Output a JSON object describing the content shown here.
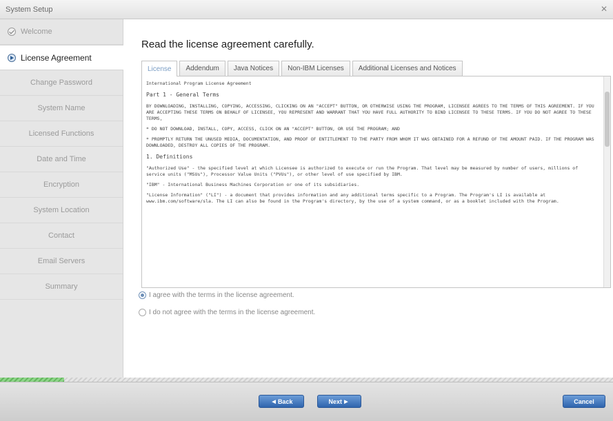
{
  "window": {
    "title": "System Setup",
    "close_icon": "close-icon"
  },
  "sidebar": {
    "items": [
      {
        "label": "Welcome",
        "state": "done",
        "icon": "check-circle-icon"
      },
      {
        "label": "License Agreement",
        "state": "active",
        "icon": "arrow-circle-icon"
      },
      {
        "label": "Change Password",
        "state": "pending"
      },
      {
        "label": "System Name",
        "state": "pending"
      },
      {
        "label": "Licensed Functions",
        "state": "pending"
      },
      {
        "label": "Date and Time",
        "state": "pending"
      },
      {
        "label": "Encryption",
        "state": "pending"
      },
      {
        "label": "System Location",
        "state": "pending"
      },
      {
        "label": "Contact",
        "state": "pending"
      },
      {
        "label": "Email Servers",
        "state": "pending"
      },
      {
        "label": "Summary",
        "state": "pending"
      }
    ]
  },
  "main": {
    "heading": "Read the license agreement carefully.",
    "tabs": [
      {
        "label": "License",
        "active": true
      },
      {
        "label": "Addendum",
        "active": false
      },
      {
        "label": "Java Notices",
        "active": false
      },
      {
        "label": "Non-IBM Licenses",
        "active": false
      },
      {
        "label": "Additional Licenses and Notices",
        "active": false
      }
    ],
    "license": {
      "paragraphs": [
        "International Program License Agreement",
        "Part 1 - General Terms",
        "BY DOWNLOADING, INSTALLING, COPYING, ACCESSING, CLICKING ON AN \"ACCEPT\" BUTTON, OR OTHERWISE USING THE PROGRAM, LICENSEE AGREES TO THE TERMS OF THIS AGREEMENT. IF YOU ARE ACCEPTING THESE TERMS ON BEHALF OF LICENSEE, YOU REPRESENT AND WARRANT THAT YOU HAVE FULL AUTHORITY TO BIND LICENSEE TO THESE TERMS. IF YOU DO NOT AGREE TO THESE TERMS,",
        "* DO NOT DOWNLOAD, INSTALL, COPY, ACCESS, CLICK ON AN \"ACCEPT\" BUTTON, OR USE THE PROGRAM; AND",
        "* PROMPTLY RETURN THE UNUSED MEDIA, DOCUMENTATION, AND PROOF OF ENTITLEMENT TO THE PARTY FROM WHOM IT WAS OBTAINED FOR A REFUND OF THE AMOUNT PAID. IF THE PROGRAM WAS DOWNLOADED, DESTROY ALL COPIES OF THE PROGRAM.",
        "1. Definitions",
        "\"Authorized Use\" - the specified level at which Licensee is authorized to execute or run the Program. That level may be measured by number of users, millions of service units (\"MSUs\"), Processor Value Units (\"PVUs\"), or other level of use specified by IBM.",
        "\"IBM\" - International Business Machines Corporation or one of its subsidiaries.",
        "\"License Information\" (\"LI\") - a document that provides information and any additional terms specific to a Program. The Program's LI is available at www.ibm.com/software/sla. The LI can also be found in the Program's directory, by the use of a system command, or as a booklet included with the Program."
      ]
    },
    "agreement": {
      "agree_label": "I agree with the terms in the license agreement.",
      "disagree_label": "I do not agree with the terms in the license agreement.",
      "selected": "agree"
    }
  },
  "progress": {
    "fraction": 0.105
  },
  "footer": {
    "back_label": "Back",
    "next_label": "Next",
    "cancel_label": "Cancel"
  },
  "colors": {
    "button_blue": "#2f64ad",
    "progress_green": "#64b75e",
    "tab_active_text": "#7a9dc4"
  }
}
